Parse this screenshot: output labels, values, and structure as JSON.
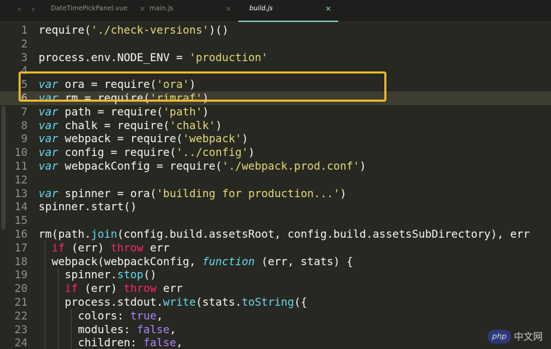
{
  "tabs": [
    {
      "label": "DateTimePickPanel.vue",
      "close": "×",
      "active": false
    },
    {
      "label": "main.js",
      "close": "×",
      "active": false
    },
    {
      "label": "build.js",
      "close": "×",
      "active": true
    }
  ],
  "nav": {
    "back": "‹",
    "forward": "›"
  },
  "editor": {
    "current_line": 6,
    "highlighted_lines": [
      3,
      4
    ],
    "highlight_color": "#f5b82e",
    "lines": [
      {
        "n": "1",
        "tokens": [
          [
            "p",
            "require("
          ],
          [
            "s",
            "'./check-versions'"
          ],
          [
            "p",
            ")()"
          ]
        ]
      },
      {
        "n": "2",
        "tokens": []
      },
      {
        "n": "3",
        "tokens": [
          [
            "p",
            "process.env.NODE_ENV = "
          ],
          [
            "s",
            "'production'"
          ]
        ]
      },
      {
        "n": "4",
        "tokens": []
      },
      {
        "n": "5",
        "tokens": [
          [
            "k",
            "var"
          ],
          [
            "p",
            " ora = require("
          ],
          [
            "s",
            "'ora'"
          ],
          [
            "p",
            ")"
          ]
        ]
      },
      {
        "n": "6",
        "tokens": [
          [
            "k",
            "var"
          ],
          [
            "p",
            " rm = require("
          ],
          [
            "s",
            "'rimraf'"
          ],
          [
            "p",
            ")"
          ]
        ]
      },
      {
        "n": "7",
        "tokens": [
          [
            "k",
            "var"
          ],
          [
            "p",
            " path = require("
          ],
          [
            "s",
            "'path'"
          ],
          [
            "p",
            ")"
          ]
        ]
      },
      {
        "n": "8",
        "tokens": [
          [
            "k",
            "var"
          ],
          [
            "p",
            " chalk = require("
          ],
          [
            "s",
            "'chalk'"
          ],
          [
            "p",
            ")"
          ]
        ]
      },
      {
        "n": "9",
        "tokens": [
          [
            "k",
            "var"
          ],
          [
            "p",
            " webpack = require("
          ],
          [
            "s",
            "'webpack'"
          ],
          [
            "p",
            ")"
          ]
        ]
      },
      {
        "n": "10",
        "tokens": [
          [
            "k",
            "var"
          ],
          [
            "p",
            " config = require("
          ],
          [
            "s",
            "'../config'"
          ],
          [
            "p",
            ")"
          ]
        ]
      },
      {
        "n": "11",
        "tokens": [
          [
            "k",
            "var"
          ],
          [
            "p",
            " webpackConfig = require("
          ],
          [
            "s",
            "'./webpack.prod.conf'"
          ],
          [
            "p",
            ")"
          ]
        ]
      },
      {
        "n": "12",
        "tokens": []
      },
      {
        "n": "13",
        "tokens": [
          [
            "k",
            "var"
          ],
          [
            "p",
            " spinner = ora("
          ],
          [
            "s",
            "'building for production...'"
          ],
          [
            "p",
            ")"
          ]
        ]
      },
      {
        "n": "14",
        "tokens": [
          [
            "p",
            "spinner.start()"
          ]
        ]
      },
      {
        "n": "15",
        "tokens": []
      },
      {
        "n": "16",
        "tokens": [
          [
            "p",
            "rm(path."
          ],
          [
            "f",
            "join"
          ],
          [
            "p",
            "(config.build.assetsRoot, config.build.assetsSubDirectory), err"
          ]
        ]
      },
      {
        "n": "17",
        "tokens": [
          [
            "p",
            "  "
          ],
          [
            "kw",
            "if"
          ],
          [
            "p",
            " (err) "
          ],
          [
            "kw",
            "throw"
          ],
          [
            "p",
            " err"
          ]
        ]
      },
      {
        "n": "18",
        "tokens": [
          [
            "p",
            "  webpack(webpackConfig, "
          ],
          [
            "k",
            "function"
          ],
          [
            "p",
            " (err, stats) {"
          ]
        ]
      },
      {
        "n": "19",
        "tokens": [
          [
            "p",
            "    spinner."
          ],
          [
            "f",
            "stop"
          ],
          [
            "p",
            "()"
          ]
        ]
      },
      {
        "n": "20",
        "tokens": [
          [
            "p",
            "    "
          ],
          [
            "kw",
            "if"
          ],
          [
            "p",
            " (err) "
          ],
          [
            "kw",
            "throw"
          ],
          [
            "p",
            " err"
          ]
        ]
      },
      {
        "n": "21",
        "tokens": [
          [
            "p",
            "    process.stdout."
          ],
          [
            "f",
            "write"
          ],
          [
            "p",
            "(stats."
          ],
          [
            "f",
            "toString"
          ],
          [
            "p",
            "({"
          ]
        ]
      },
      {
        "n": "22",
        "tokens": [
          [
            "p",
            "      colors: "
          ],
          [
            "c",
            "true"
          ],
          [
            "p",
            ","
          ]
        ]
      },
      {
        "n": "23",
        "tokens": [
          [
            "p",
            "      modules: "
          ],
          [
            "c",
            "false"
          ],
          [
            "p",
            ","
          ]
        ]
      },
      {
        "n": "24",
        "tokens": [
          [
            "p",
            "      children: "
          ],
          [
            "c",
            "false"
          ],
          [
            "p",
            ","
          ]
        ]
      }
    ]
  },
  "watermark": {
    "badge": "php",
    "text": "中文网"
  }
}
